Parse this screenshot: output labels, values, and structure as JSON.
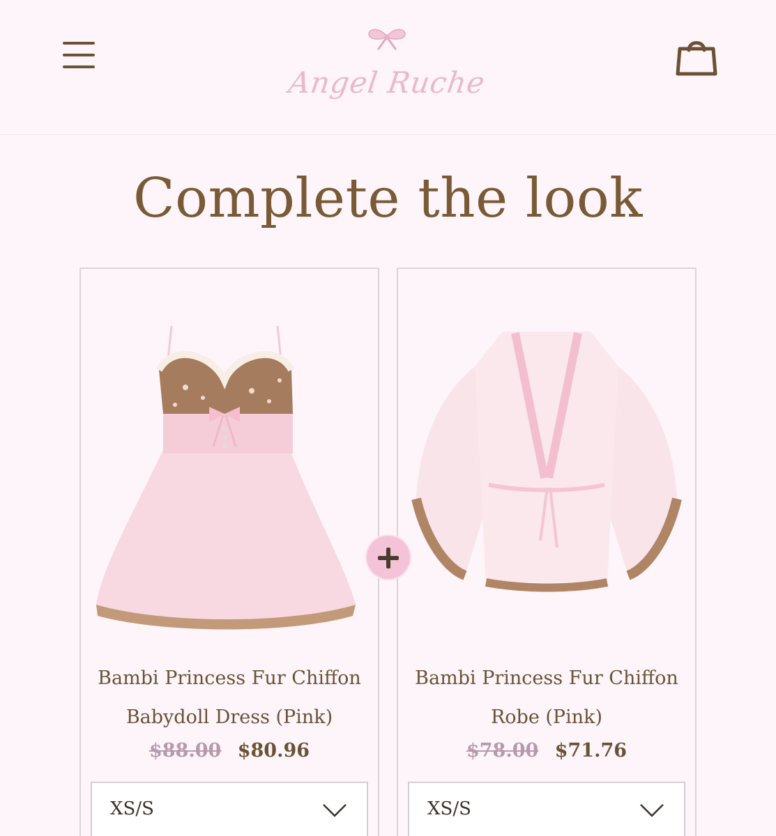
{
  "header": {
    "brand": "Angel Ruche",
    "menu_icon": "hamburger-menu-icon",
    "cart_icon": "shopping-bag-icon",
    "logo_icon": "bow-icon"
  },
  "section": {
    "title": "Complete the look",
    "plus_icon": "plus-icon"
  },
  "products": [
    {
      "name_line1": "Bambi Princess Fur Chiffon",
      "name_line2": "Babydoll Dress (Pink)",
      "price_old": "$88.00",
      "price_new": "$80.96",
      "size": "XS/S"
    },
    {
      "name_line1": "Bambi Princess Fur Chiffon",
      "name_line2": "Robe (Pink)",
      "price_old": "$78.00",
      "price_new": "$71.76",
      "size": "XS/S"
    }
  ],
  "colors": {
    "background": "#fdf5f9",
    "text_brown": "#6b5236",
    "brand_pink": "#eab8cc",
    "accent_pink": "#f5c3d8",
    "strike_price": "#b799ad"
  }
}
